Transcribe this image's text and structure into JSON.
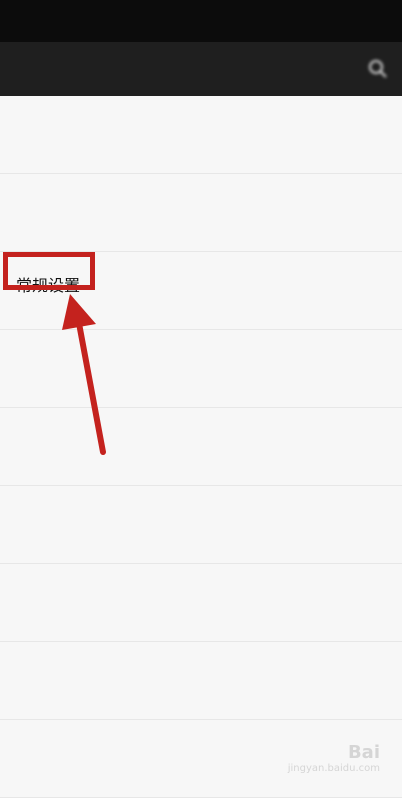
{
  "status_bar": {
    "left_text": "",
    "right_text": ""
  },
  "toolbar": {
    "title": "",
    "search_icon": "search-icon"
  },
  "settings": [
    {
      "title": "",
      "subtitle": ""
    },
    {
      "title": "",
      "subtitle": ""
    },
    {
      "title": "常规设置",
      "subtitle": ""
    },
    {
      "title": "",
      "subtitle": ""
    },
    {
      "title": "",
      "subtitle": ""
    },
    {
      "title": "",
      "subtitle": ""
    },
    {
      "title": "",
      "subtitle": ""
    },
    {
      "title": "",
      "subtitle": ""
    },
    {
      "title": "",
      "subtitle": ""
    }
  ],
  "annotation": {
    "color": "#c4221e"
  },
  "watermark": {
    "brand": "Bai",
    "domain": "jingyan.baidu.com"
  }
}
